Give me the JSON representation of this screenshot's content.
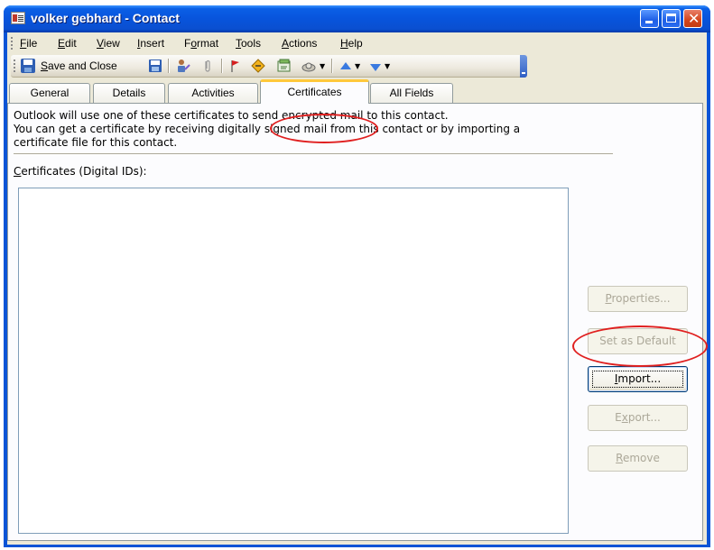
{
  "window": {
    "title": "volker gebhard - Contact",
    "icon": "contact-card-icon",
    "controls": [
      "minimize",
      "maximize",
      "close"
    ],
    "colors": {
      "titlebar": "#0a54d6",
      "close_button": "#d4451c",
      "face": "#ece9d8"
    }
  },
  "menu": {
    "items": [
      {
        "label": "File",
        "key": "F"
      },
      {
        "label": "Edit",
        "key": "E"
      },
      {
        "label": "View",
        "key": "V"
      },
      {
        "label": "Insert",
        "key": "I"
      },
      {
        "label": "Format",
        "key": "o"
      },
      {
        "label": "Tools",
        "key": "T"
      },
      {
        "label": "Actions",
        "key": "A"
      },
      {
        "label": "Help",
        "key": "H"
      }
    ]
  },
  "toolbar": {
    "save_and_close": "Save and Close",
    "icons": [
      "save-icon",
      "save-contact-icon",
      "new-contact-icon",
      "attach-icon",
      "flag-icon",
      "activity-icon",
      "card-icon",
      "dial-icon",
      "previous-item-icon",
      "next-item-icon"
    ]
  },
  "tabs": {
    "items": [
      "General",
      "Details",
      "Activities",
      "Certificates",
      "All Fields"
    ],
    "active": "Certificates"
  },
  "certificates": {
    "description_lines": [
      "Outlook will use one of these certificates to send encrypted mail to this contact.",
      "You can get a certificate by receiving digitally signed mail from this contact or by importing a",
      "certificate file for this contact."
    ],
    "list_label": "Certificates (Digital IDs):",
    "list_items": [],
    "buttons": {
      "properties": "Properties...",
      "set_default": "Set as Default",
      "import": "Import...",
      "export": "Export...",
      "remove": "Remove"
    },
    "enabled": {
      "properties": false,
      "set_default": false,
      "import": true,
      "export": false,
      "remove": false
    }
  },
  "annotations": {
    "highlight_color": "#e02020",
    "highlighted": [
      "tab-certificates",
      "import-button"
    ]
  }
}
